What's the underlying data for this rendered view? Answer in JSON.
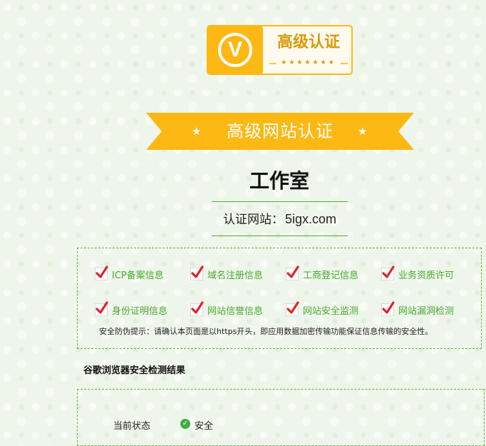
{
  "logo": {
    "letter": "V",
    "title": "高级认证"
  },
  "ribbon": {
    "title": "高级网站认证",
    "star": "★"
  },
  "company": {
    "name": "工作室"
  },
  "site": {
    "label": "认证网站：",
    "domain": "5igx.com"
  },
  "checks": [
    "ICP备案信息",
    "域名注册信息",
    "工商登记信息",
    "业务资质许可",
    "身份证明信息",
    "网站信誉信息",
    "网站安全监测",
    "网站漏洞检测"
  ],
  "tip": "安全防伪提示：请确认本页面是以https开头，即应用数据加密传输功能保证信息传输的安全性。",
  "browser_check": {
    "title": "谷歌浏览器安全检测结果",
    "status_label": "当前状态",
    "status_value": "安全"
  },
  "colors": {
    "gold": "#fdb813",
    "green": "#4aa832",
    "check_red": "#e0242b",
    "background": "#eef5ea"
  }
}
